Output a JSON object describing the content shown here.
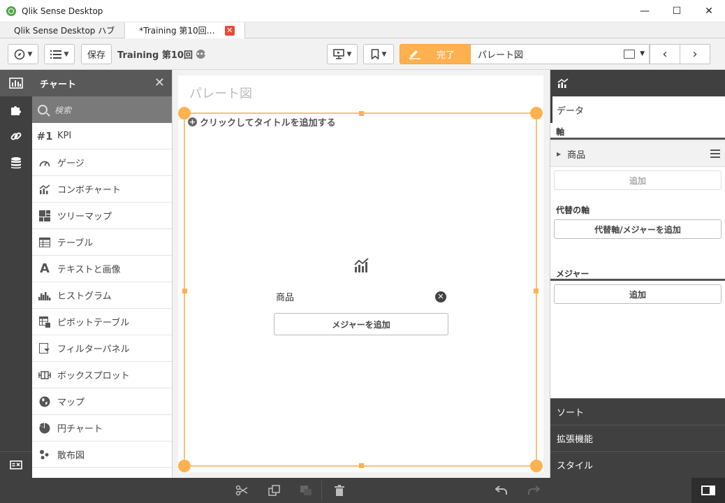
{
  "window": {
    "title": "Qlik Sense Desktop",
    "minimize": "—",
    "maximize": "☐",
    "close": "✕"
  },
  "tabs": [
    {
      "label": "Qlik Sense Desktop ハブ"
    },
    {
      "label": "*Training 第10回…",
      "close": "✕"
    }
  ],
  "toolbar": {
    "save_label": "保存",
    "app_name": "Training 第10回",
    "more": "•••",
    "done_label": "完了",
    "sheet_name": "パレート図",
    "prev": "‹",
    "next": "›"
  },
  "assets": {
    "header": "チャート",
    "close": "✕",
    "search_placeholder": "検索",
    "items": [
      {
        "label": "KPI",
        "icon": "#1"
      },
      {
        "label": "ゲージ",
        "icon": "gauge-icon"
      },
      {
        "label": "コンボチャート",
        "icon": "combo-chart-icon"
      },
      {
        "label": "ツリーマップ",
        "icon": "treemap-icon"
      },
      {
        "label": "テーブル",
        "icon": "table-icon"
      },
      {
        "label": "テキストと画像",
        "icon": "text-image-icon"
      },
      {
        "label": "ヒストグラム",
        "icon": "histogram-icon"
      },
      {
        "label": "ピボットテーブル",
        "icon": "pivot-table-icon"
      },
      {
        "label": "フィルターパネル",
        "icon": "filter-pane-icon"
      },
      {
        "label": "ボックスプロット",
        "icon": "box-plot-icon"
      },
      {
        "label": "マップ",
        "icon": "map-icon"
      },
      {
        "label": "円チャート",
        "icon": "pie-chart-icon"
      },
      {
        "label": "散布図",
        "icon": "scatter-plot-icon"
      }
    ]
  },
  "canvas": {
    "sheet_title": "パレート図",
    "add_title": "クリックしてタイトルを追加する",
    "dimension": "商品",
    "add_measure": "メジャーを追加"
  },
  "properties": {
    "data_tab": "データ",
    "dimensions_title": "軸",
    "dimension_item": "商品",
    "add_dimension": "追加",
    "alt_dimensions_title": "代替の軸",
    "add_alternative": "代替軸/メジャーを追加",
    "measures_title": "メジャー",
    "add_measure": "追加",
    "sections": [
      "ソート",
      "拡張機能",
      "スタイル"
    ]
  },
  "colors": {
    "accent": "#ffb14f",
    "dark_panel": "#404040",
    "selection_border": "#f8c07a"
  }
}
